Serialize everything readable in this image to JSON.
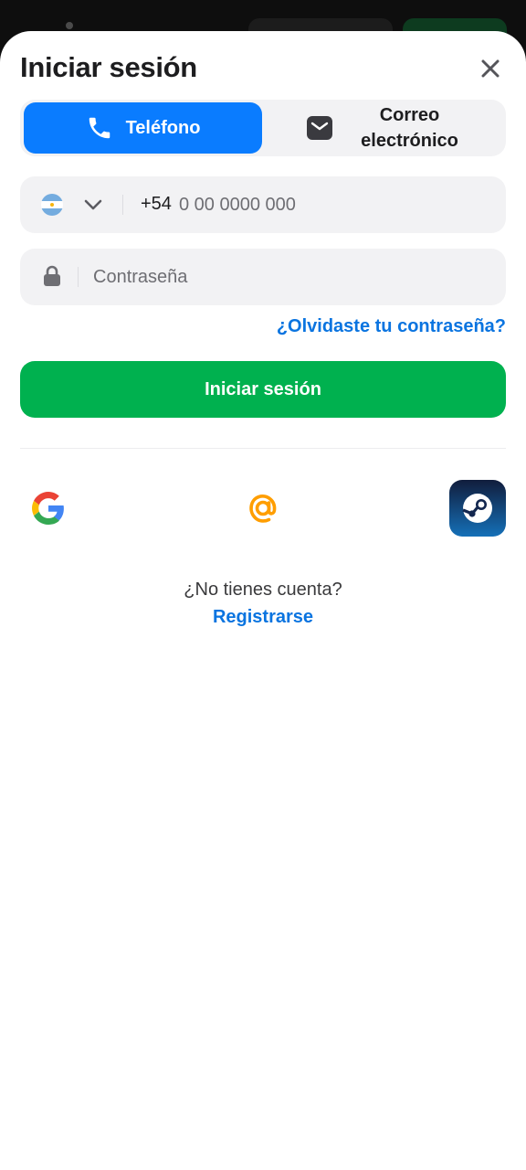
{
  "colors": {
    "accent_blue": "#0a7cff",
    "link_blue": "#0a74e0",
    "primary_green": "#00b14f",
    "field_bg": "#f2f2f4"
  },
  "header": {
    "title": "Iniciar sesión",
    "close_icon": "close-icon"
  },
  "tabs": [
    {
      "label": "Teléfono",
      "icon": "phone-icon",
      "selected": true
    },
    {
      "label": "Correo electrónico",
      "icon": "mail-icon",
      "selected": false
    }
  ],
  "phone": {
    "country_flag": "argentina-flag-icon",
    "code": "+54",
    "placeholder": "0 00 0000 000",
    "value": ""
  },
  "password": {
    "placeholder": "Contraseña",
    "value": ""
  },
  "forgot_password": "¿Olvidaste tu contraseña?",
  "login_button": "Iniciar sesión",
  "social_logins": [
    {
      "name": "google-icon",
      "color": "#f2f2f4"
    },
    {
      "name": "vk-icon",
      "color": "#0077ff"
    },
    {
      "name": "telegram-icon",
      "color": "#2aa3dc"
    },
    {
      "name": "mail-ru-icon",
      "color": "#005ff9"
    },
    {
      "name": "yandex-icon",
      "color": "#fc3f1d"
    },
    {
      "name": "odnoklassniki-icon",
      "color": "#f7800b"
    },
    {
      "name": "steam-icon",
      "color": "#0f2550"
    }
  ],
  "footer": {
    "no_account": "¿No tienes cuenta?",
    "register": "Registrarse"
  }
}
